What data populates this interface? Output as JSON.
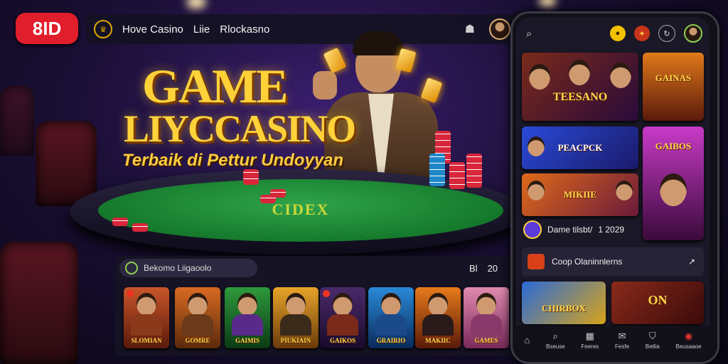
{
  "brand": {
    "logo_text": "8ID",
    "icon": "crown-icon"
  },
  "topbar": {
    "nav": [
      "Ноve Casino",
      "Liie",
      "Rlockasno"
    ],
    "bell_icon": "notification-icon",
    "avatar": "user-avatar"
  },
  "hero": {
    "title": "GAME",
    "subtitle": "LIYCCASINO",
    "tagline": "Terbaik di Pettur Undoyyan",
    "table_logo": "CIDEX"
  },
  "panel": {
    "search_label": "Bekomo Liigaoolo",
    "count_a": "Bl",
    "count_b": "20",
    "tiles": [
      {
        "caption": "SLOMIAN",
        "color": "#c8552a"
      },
      {
        "caption": "GOMRE",
        "color": "#d96a22"
      },
      {
        "caption": "GAIMIS",
        "color": "#2e9a3c"
      },
      {
        "caption": "PIUKIAIN",
        "color": "#e8a42a"
      },
      {
        "caption": "GAIKOS",
        "color": "#4a2a6a"
      },
      {
        "caption": "GRAIRIO",
        "color": "#2a8ad8"
      },
      {
        "caption": "MAKIIC",
        "color": "#e87a1a"
      },
      {
        "caption": "GAMES",
        "color": "#e08ab0"
      }
    ]
  },
  "phone": {
    "search_icon": "search-icon",
    "top_icons": [
      "coin-icon",
      "fire-icon",
      "refresh-icon",
      "profile-icon"
    ],
    "cards": {
      "featured": "TEESANO",
      "side_top": "GAINAS",
      "promo": "PEACPCK",
      "side_tall": "GAIBOS",
      "wide": "MIKIIE"
    },
    "info_row": {
      "label": "Dame tilsbt/",
      "value": "1 2029"
    },
    "list_row": {
      "label": "Coop Olaninnlerns"
    },
    "bottom_cards": [
      "CHIRBOX",
      "ON"
    ],
    "nav": [
      {
        "icon": "home-icon",
        "label": ""
      },
      {
        "icon": "search-icon",
        "label": "Bseuse"
      },
      {
        "icon": "grid-icon",
        "label": "Feeres"
      },
      {
        "icon": "mail-icon",
        "label": "Fesfe"
      },
      {
        "icon": "shield-icon",
        "label": "Betlia"
      },
      {
        "icon": "live-icon",
        "label": "Beusaaoe"
      }
    ]
  }
}
